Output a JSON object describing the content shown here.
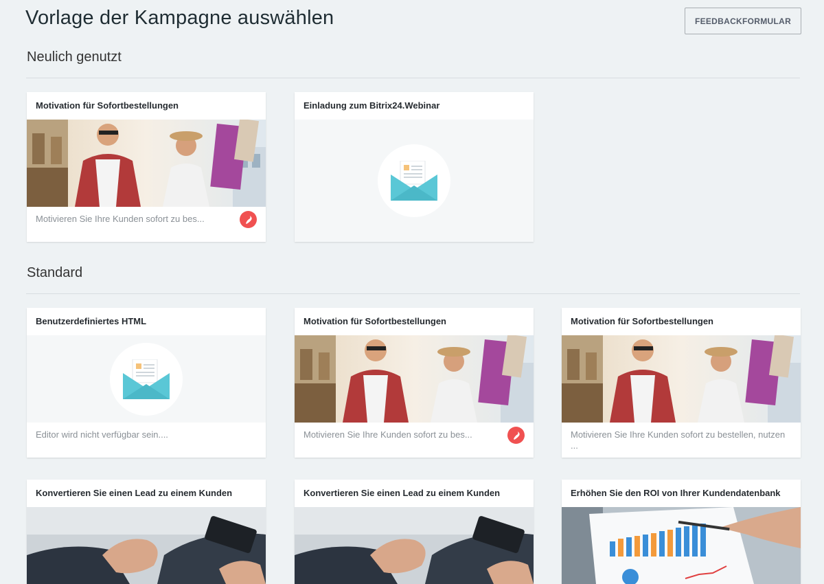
{
  "header": {
    "title": "Vorlage der Kampagne auswählen",
    "feedback_label": "FEEDBACKFORMULAR"
  },
  "recent": {
    "title": "Neulich genutzt",
    "cards": [
      {
        "title": "Motivation für Sofortbestellungen",
        "desc": "Motivieren Sie Ihre Kunden sofort zu bes..."
      },
      {
        "title": "Einladung zum Bitrix24.Webinar",
        "desc": ""
      }
    ]
  },
  "standard": {
    "title": "Standard",
    "cards": [
      {
        "title": "Benutzerdefiniertes HTML",
        "desc": "Editor wird nicht verfügbar sein...."
      },
      {
        "title": "Motivation für Sofortbestellungen",
        "desc": "Motivieren Sie Ihre Kunden sofort zu bes..."
      },
      {
        "title": "Motivation für Sofortbestellungen",
        "desc": "Motivieren Sie Ihre Kunden sofort zu bestellen, nutzen ..."
      },
      {
        "title": "Konvertieren Sie einen Lead zu einem Kunden",
        "desc": ""
      },
      {
        "title": "Konvertieren Sie einen Lead zu einem Kunden",
        "desc": ""
      },
      {
        "title": "Erhöhen Sie den ROI von Ihrer Kundendatenbank",
        "desc": ""
      }
    ]
  },
  "icons": {
    "envelope": "envelope-icon",
    "flame": "flame-icon"
  },
  "colors": {
    "background": "#eef2f4",
    "badge": "#f05151",
    "envelope": "#5ac7d6"
  }
}
